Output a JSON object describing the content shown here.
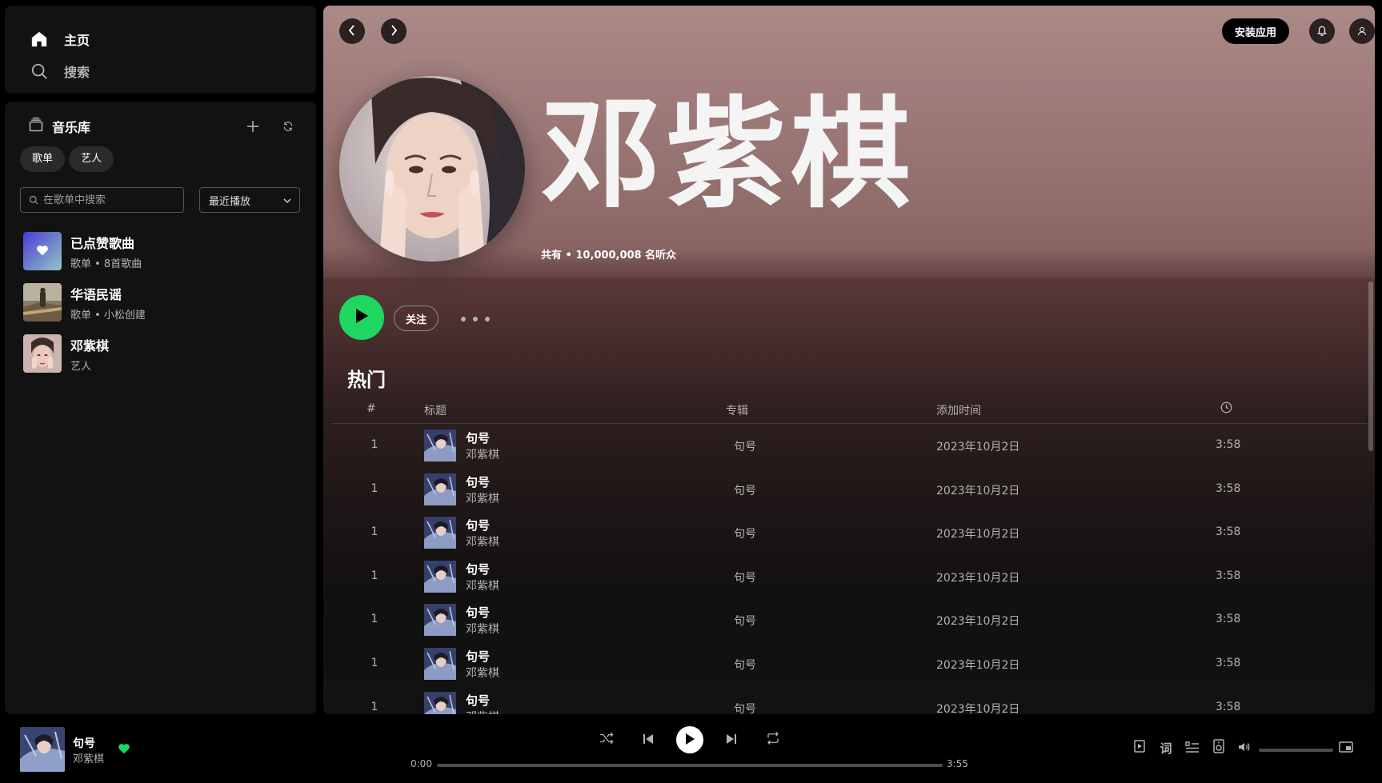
{
  "nav": {
    "home": "主页",
    "search": "搜索"
  },
  "library": {
    "title": "音乐库",
    "chips": [
      "歌单",
      "艺人"
    ],
    "search_placeholder": "在歌单中搜索",
    "sort_label": "最近播放",
    "items": [
      {
        "name": "已点赞歌曲",
        "sub": "歌单 • 8首歌曲"
      },
      {
        "name": "华语民谣",
        "sub": "歌单 • 小松创建"
      },
      {
        "name": "邓紫棋",
        "sub": "艺人"
      }
    ]
  },
  "header": {
    "install_label": "安装应用"
  },
  "artist": {
    "name": "邓紫棋",
    "listeners": "共有 • 10,000,008 名听众",
    "follow_label": "关注"
  },
  "popular": {
    "title": "热门",
    "columns": {
      "num": "#",
      "title": "标题",
      "album": "专辑",
      "added": "添加时间"
    },
    "rows": [
      {
        "num": "1",
        "title": "句号",
        "artist": "邓紫棋",
        "album": "句号",
        "added": "2023年10月2日",
        "duration": "3:58"
      },
      {
        "num": "1",
        "title": "句号",
        "artist": "邓紫棋",
        "album": "句号",
        "added": "2023年10月2日",
        "duration": "3:58"
      },
      {
        "num": "1",
        "title": "句号",
        "artist": "邓紫棋",
        "album": "句号",
        "added": "2023年10月2日",
        "duration": "3:58"
      },
      {
        "num": "1",
        "title": "句号",
        "artist": "邓紫棋",
        "album": "句号",
        "added": "2023年10月2日",
        "duration": "3:58"
      },
      {
        "num": "1",
        "title": "句号",
        "artist": "邓紫棋",
        "album": "句号",
        "added": "2023年10月2日",
        "duration": "3:58"
      },
      {
        "num": "1",
        "title": "句号",
        "artist": "邓紫棋",
        "album": "句号",
        "added": "2023年10月2日",
        "duration": "3:58"
      },
      {
        "num": "1",
        "title": "句号",
        "artist": "邓紫棋",
        "album": "句号",
        "added": "2023年10月2日",
        "duration": "3:58"
      }
    ]
  },
  "player": {
    "title": "句号",
    "artist": "邓紫棋",
    "elapsed": "0:00",
    "total": "3:55",
    "progress": 0.0,
    "volume": 0.0
  },
  "colors": {
    "accent": "#1ed760",
    "liked_gradient_start": "#4a3bd4",
    "liked_gradient_end": "#8fc7c6"
  }
}
